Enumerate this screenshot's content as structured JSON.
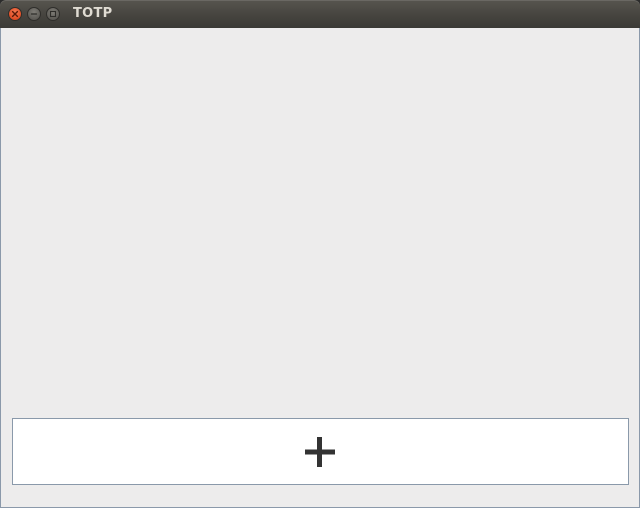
{
  "window": {
    "title": "TOTP",
    "controls": {
      "close_icon": "close-icon",
      "minimize_icon": "minimize-icon",
      "maximize_icon": "maximize-icon"
    }
  },
  "main": {
    "add_button": {
      "icon": "plus-icon"
    }
  },
  "colors": {
    "titlebar": "#46443f",
    "close": "#e2522a",
    "content_bg": "#edecec",
    "button_bg": "#ffffff",
    "button_border": "#8a99aa",
    "icon": "#333333"
  }
}
